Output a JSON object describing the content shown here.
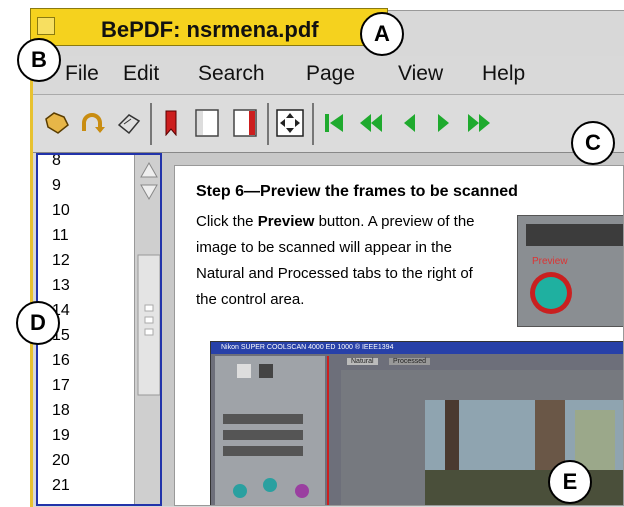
{
  "window": {
    "title": "BePDF: nsrmena.pdf"
  },
  "menu": [
    "File",
    "Edit",
    "Search",
    "Page",
    "View",
    "Help"
  ],
  "toolbar": {
    "icons": [
      "open-file-icon",
      "reload-icon",
      "print-icon",
      "bookmark-icon",
      "single-page-icon",
      "two-page-icon",
      "fit-page-icon",
      "first-page-icon",
      "previous-ten-pages-icon",
      "previous-page-icon",
      "next-page-icon",
      "next-ten-pages-icon"
    ]
  },
  "sidebar": {
    "pages": [
      "8",
      "9",
      "10",
      "11",
      "12",
      "13",
      "14",
      "15",
      "16",
      "17",
      "18",
      "19",
      "20",
      "21"
    ]
  },
  "document": {
    "step_heading": "Step 6—Preview the frames to be scanned",
    "body_prefix": "Click the ",
    "body_bold": "Preview",
    "body_suffix": " button. A preview of the image to be scanned will appear in the Natural and Processed tabs to the right of the control area.",
    "preview_label": "Preview",
    "scanner_window_title": "Nikon SUPER COOLSCAN 4000 ED 1000 ® IEEE1394",
    "tab_natural": "Natural",
    "tab_processed": "Processed"
  },
  "callouts": [
    "A",
    "B",
    "C",
    "D",
    "E"
  ],
  "colors": {
    "title_bar": "#f5d21e",
    "nav_green": "#1faa2e",
    "sidebar_border": "#2233aa"
  }
}
